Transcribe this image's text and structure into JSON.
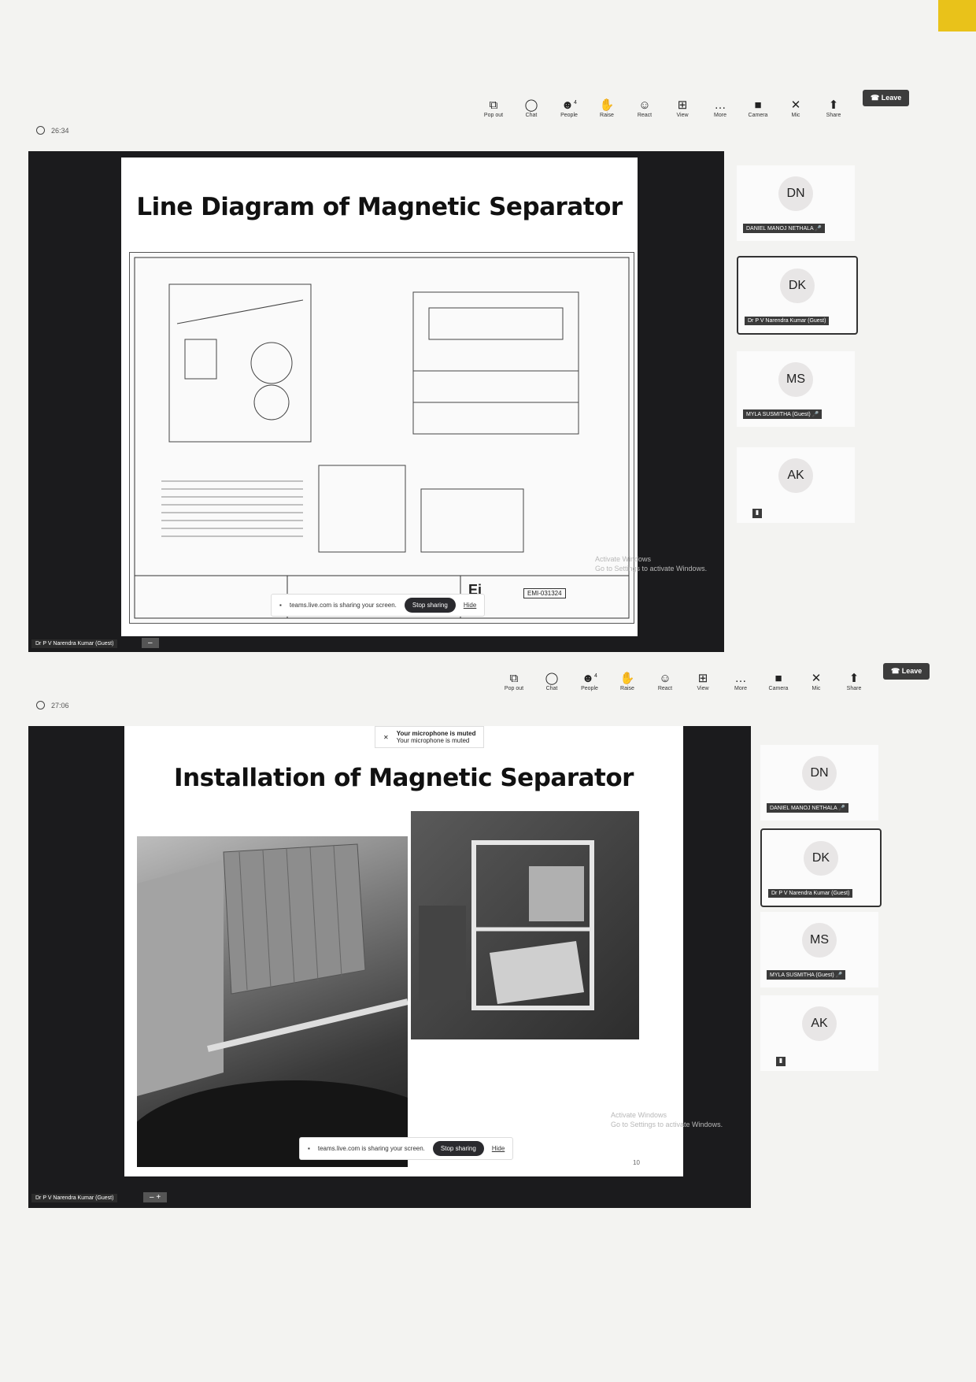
{
  "toolbar": {
    "buttons": [
      {
        "label": "Pop out",
        "icon": "pop-out-icon"
      },
      {
        "label": "Chat",
        "icon": "chat-icon"
      },
      {
        "label": "People",
        "icon": "people-icon",
        "badge": "4"
      },
      {
        "label": "Raise",
        "icon": "raise-hand-icon"
      },
      {
        "label": "React",
        "icon": "react-icon"
      },
      {
        "label": "View",
        "icon": "view-icon"
      },
      {
        "label": "More",
        "icon": "more-icon"
      },
      {
        "label": "Camera",
        "icon": "camera-off-icon"
      },
      {
        "label": "Mic",
        "icon": "mic-off-icon"
      },
      {
        "label": "Share",
        "icon": "share-icon"
      }
    ],
    "leave_label": "Leave"
  },
  "screenshots": [
    {
      "timer": "26:34",
      "slide_title": "Line Diagram of Magnetic Separator",
      "share_text": "teams.live.com is sharing your screen.",
      "stop_label": "Stop sharing",
      "hide_label": "Hide",
      "logo_text": "Ei",
      "drawing_ref": "EMI-031324",
      "watermark_line1": "Activate Windows",
      "watermark_line2": "Go to Settings to activate Windows.",
      "presenter": "Dr P V Narendra Kumar (Guest)"
    },
    {
      "timer": "27:06",
      "slide_title": "Installation of Magnetic Separator",
      "mute_title": "Your microphone is muted",
      "mute_sub": "Your microphone is muted",
      "share_text": "teams.live.com is sharing your screen.",
      "stop_label": "Stop sharing",
      "hide_label": "Hide",
      "slide_number": "10",
      "watermark_line1": "Activate Windows",
      "watermark_line2": "Go to Settings to activate Windows.",
      "presenter": "Dr P V Narendra Kumar (Guest)"
    }
  ],
  "participants": [
    {
      "initials": "DN",
      "name": "DANIEL MANOJ NETHALA"
    },
    {
      "initials": "DK",
      "name": "Dr P V Narendra Kumar (Guest)",
      "active": true
    },
    {
      "initials": "MS",
      "name": "MYLA SUSMITHA (Guest)"
    },
    {
      "initials": "AK",
      "name": ""
    }
  ],
  "colors": {
    "stage": "#1b1b1d",
    "leave_button": "#3c3c3c",
    "paper_corner": "#e9c21a"
  }
}
